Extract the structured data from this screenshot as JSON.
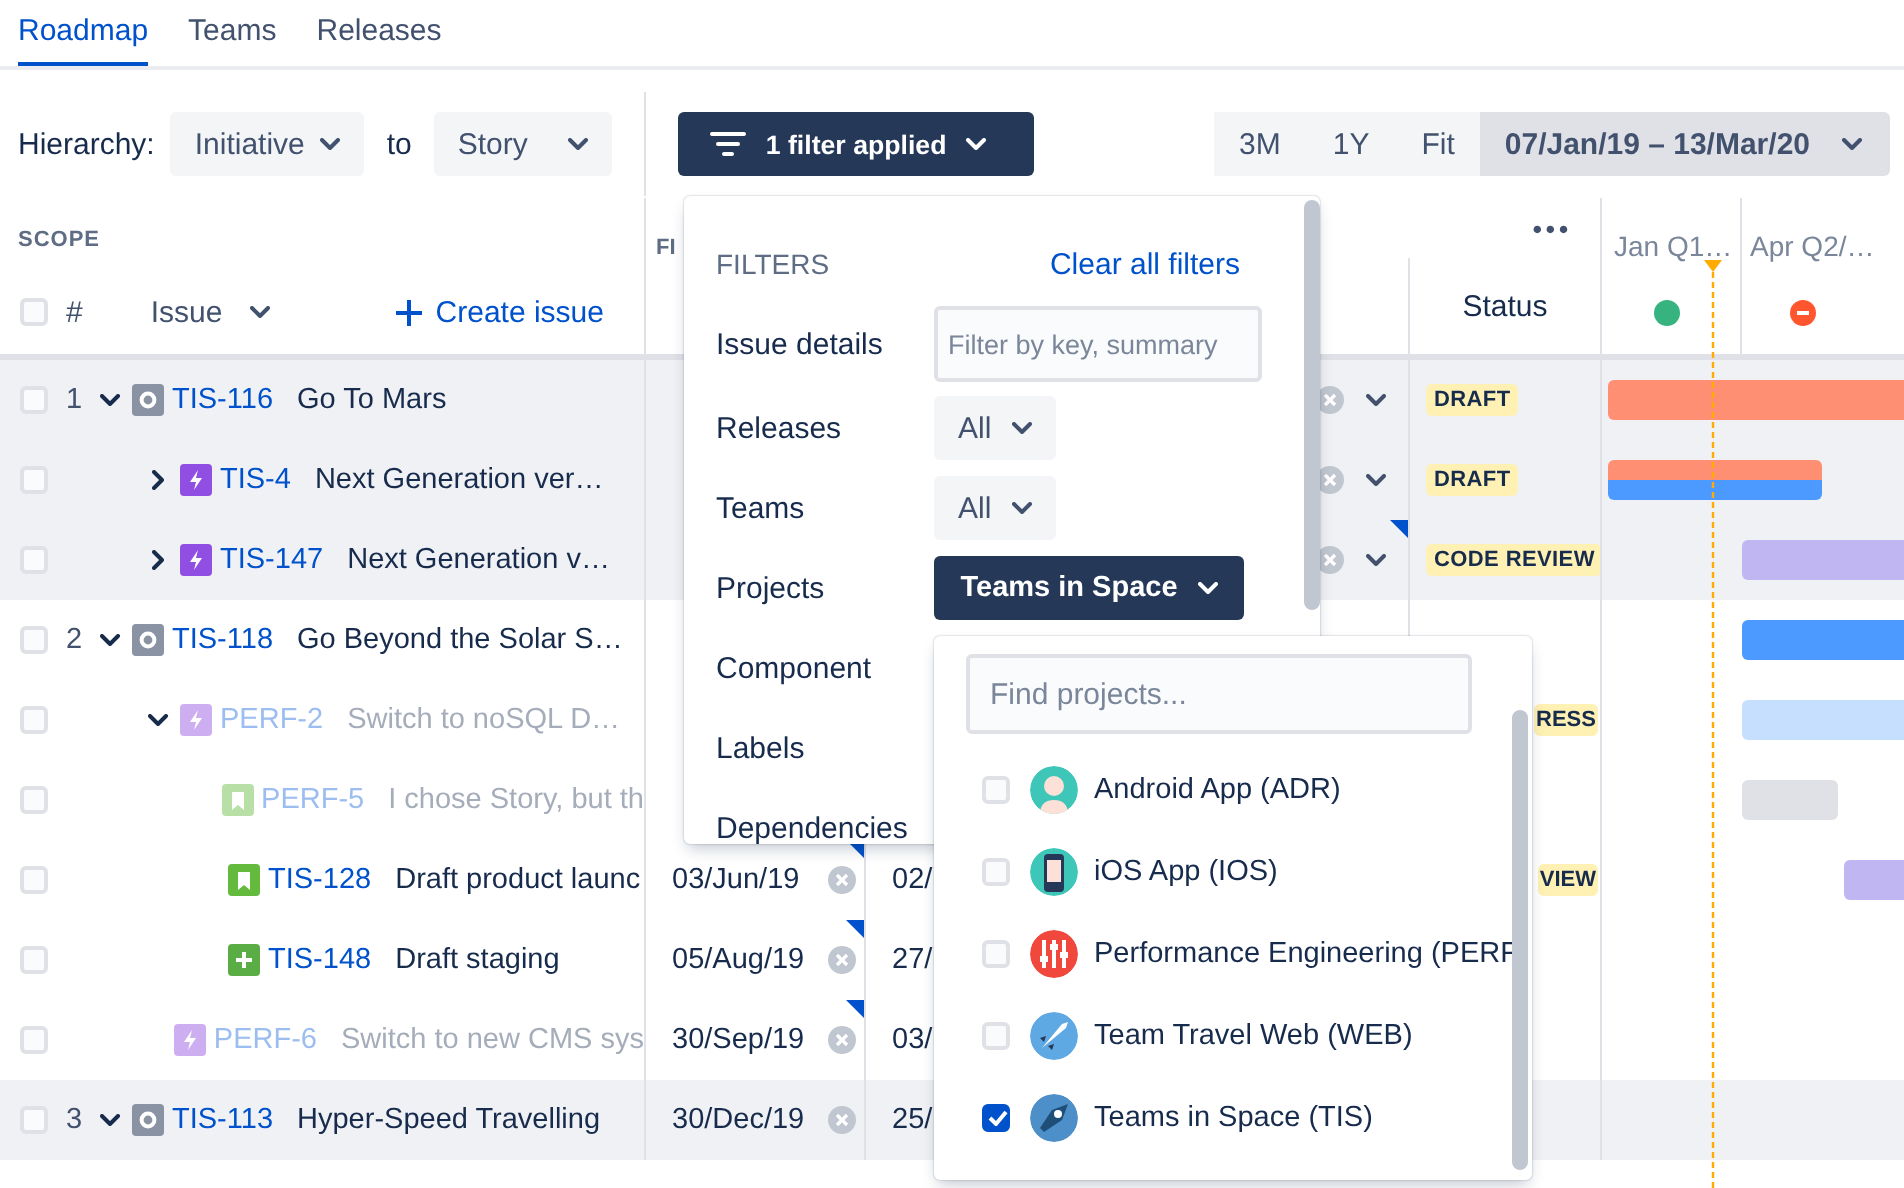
{
  "tabs": [
    {
      "label": "Roadmap",
      "selected": true
    },
    {
      "label": "Teams",
      "selected": false
    },
    {
      "label": "Releases",
      "selected": false
    }
  ],
  "toolbar": {
    "hierarchy_label": "Hierarchy:",
    "from_level": "Initiative",
    "to_label": "to",
    "to_level": "Story",
    "filter_button": "1 filter applied",
    "zoom_options": [
      {
        "label": "3M",
        "selected": false
      },
      {
        "label": "1Y",
        "selected": false
      },
      {
        "label": "Fit",
        "selected": false
      }
    ],
    "date_range": "07/Jan/19 – 13/Mar/20"
  },
  "table": {
    "scope_label": "SCOPE",
    "number_header": "#",
    "issue_header": "Issue",
    "header_checked": false,
    "create_issue": "Create issue",
    "column_2": "FI",
    "status_header": "Status",
    "more_button": "•••",
    "timeline_columns": [
      "Jan Q1…",
      "Apr Q2/…"
    ],
    "rows": [
      {
        "number": "1",
        "key": "TIS-116",
        "summary": "Go To Mars",
        "kind": "initiative",
        "expanded": true,
        "dimmed": false,
        "checked": false,
        "status": "DRAFT",
        "start_marker": false,
        "end_marker": false,
        "children": [
          {
            "key": "TIS-4",
            "summary": "Next Generation ver…",
            "kind": "epic",
            "expanded": false,
            "dimmed": false,
            "checked": false,
            "status": "DRAFT",
            "start_marker": false,
            "end_marker": false
          },
          {
            "key": "TIS-147",
            "summary": "Next Generation v…",
            "kind": "epic",
            "expanded": false,
            "dimmed": false,
            "checked": false,
            "status": "CODE REVIEW",
            "start_marker": false,
            "end_marker": true
          }
        ]
      },
      {
        "number": "2",
        "key": "TIS-118",
        "summary": "Go Beyond the Solar S…",
        "kind": "initiative",
        "expanded": true,
        "dimmed": false,
        "checked": false,
        "start_marker": false,
        "end_marker": false,
        "children": [
          {
            "key": "PERF-2",
            "summary": "Switch to noSQL D…",
            "kind": "epic",
            "expanded": true,
            "dimmed": true,
            "checked": false,
            "status": "RESS",
            "start_marker": false,
            "end_marker": false,
            "children": [
              {
                "key": "PERF-5",
                "summary": "I chose Story, but th",
                "kind": "story",
                "dimmed": true,
                "checked": false,
                "start_marker": false,
                "end_marker": false
              },
              {
                "key": "TIS-128",
                "summary": "Draft product launc",
                "kind": "story",
                "dimmed": false,
                "checked": false,
                "start": "03/Jun/19",
                "end": "02/",
                "status": "VIEW",
                "start_marker": true,
                "end_marker": false
              },
              {
                "key": "TIS-148",
                "summary": "Draft staging",
                "kind": "new_feature",
                "dimmed": false,
                "checked": false,
                "start": "05/Aug/19",
                "end": "27/",
                "start_marker": true,
                "end_marker": false
              }
            ]
          },
          {
            "key": "PERF-6",
            "summary": "Switch to new CMS sys",
            "kind": "epic",
            "dimmed": true,
            "checked": false,
            "start": "30/Sep/19",
            "end": "03/",
            "start_marker": true,
            "end_marker": false
          }
        ]
      },
      {
        "number": "3",
        "key": "TIS-113",
        "summary": "Hyper-Speed Travelling",
        "kind": "initiative",
        "expanded": true,
        "dimmed": false,
        "checked": false,
        "start": "30/Dec/19",
        "end": "25/",
        "start_marker": false,
        "end_marker": false
      }
    ]
  },
  "filters": {
    "title": "FILTERS",
    "clear_link": "Clear all filters",
    "rows": [
      {
        "label": "Issue details",
        "kind": "input",
        "placeholder": "Filter by key, summary"
      },
      {
        "label": "Releases",
        "kind": "select",
        "value": "All",
        "active": false
      },
      {
        "label": "Teams",
        "kind": "select",
        "value": "All",
        "active": false
      },
      {
        "label": "Projects",
        "kind": "select",
        "value": "Teams in Space",
        "active": true
      },
      {
        "label": "Component",
        "kind": "none"
      },
      {
        "label": "Labels",
        "kind": "none"
      },
      {
        "label": "Dependencies",
        "kind": "none"
      }
    ]
  },
  "projects": {
    "placeholder": "Find projects...",
    "items": [
      {
        "label": "Android App (ADR)",
        "kind": "figure",
        "checked": false
      },
      {
        "label": "iOS App (IOS)",
        "kind": "phone",
        "checked": false
      },
      {
        "label": "Performance Engineering (PERF",
        "kind": "sliders",
        "checked": false
      },
      {
        "label": "Team Travel Web (WEB)",
        "kind": "rocket",
        "checked": false
      },
      {
        "label": "Teams in Space (TIS)",
        "kind": "spaceship",
        "checked": true
      }
    ]
  }
}
